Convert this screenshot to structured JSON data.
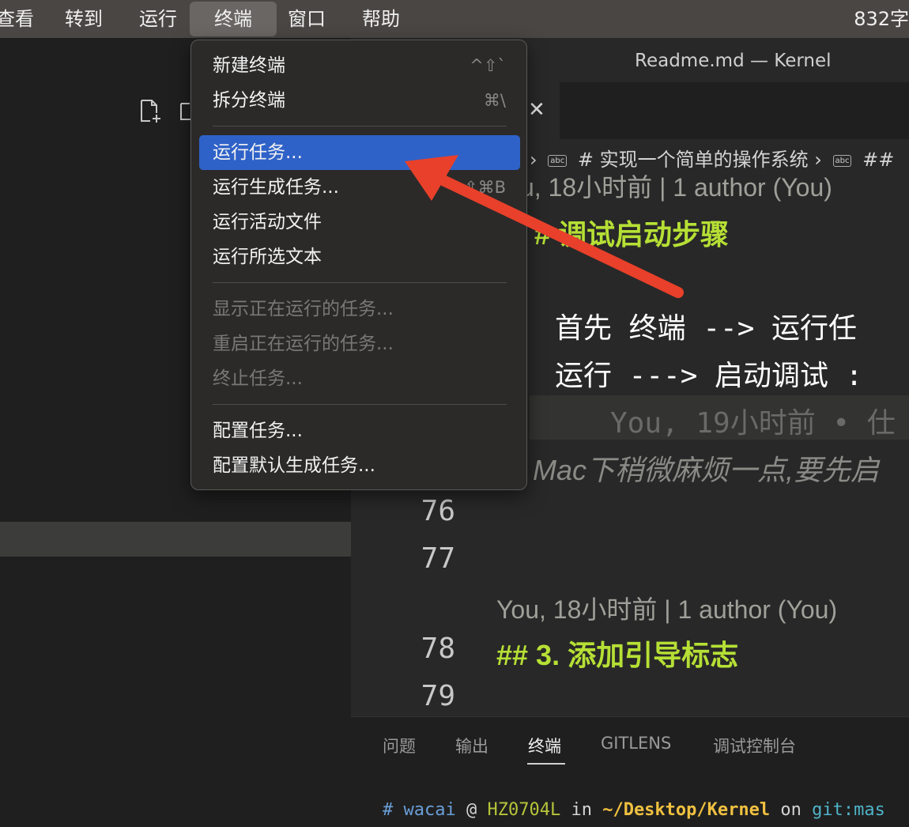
{
  "menubar": {
    "items": [
      "查看",
      "转到",
      "运行",
      "终端",
      "窗口",
      "帮助"
    ],
    "word_count": "832字"
  },
  "window_title": "Readme.md — Kernel",
  "breadcrumb": {
    "part1": "# 实现一个简单的操作系统",
    "part2": "##",
    "icon": "abc"
  },
  "editor": {
    "blame_top": "u, 18小时前 | 1 author (You)",
    "heading_top": "# 调试启动步骤",
    "line_a": "首先  终端  -->   运行任",
    "line_b": "运行  --->  启动调试  :",
    "ghost_blame": "You, 19小时前 • 仕",
    "italic_line": "Mac下稍微麻烦一点,要先启",
    "lines": [
      {
        "num": "76",
        "text": ""
      },
      {
        "num": "77",
        "text": ""
      },
      {
        "num": "78",
        "text": "## 3. 添加引导标志"
      },
      {
        "num": "79",
        "text": ""
      }
    ],
    "blame_78": "You, 18小时前 | 1 author (You)"
  },
  "panel": {
    "tabs": [
      "问题",
      "输出",
      "终端",
      "GITLENS",
      "调试控制台"
    ],
    "active_tab": "终端",
    "terminal": {
      "hash": "#",
      "user": "wacai",
      "at": "@",
      "host": "HZ0704L",
      "in": "in",
      "path": "~/Desktop/Kernel",
      "on": "on",
      "git": "git:mas"
    }
  },
  "terminal_menu": {
    "groups": [
      [
        {
          "label": "新建终端",
          "shortcut": "^⇧`",
          "disabled": false
        },
        {
          "label": "拆分终端",
          "shortcut": "⌘\\",
          "disabled": false
        }
      ],
      [
        {
          "label": "运行任务...",
          "shortcut": "",
          "disabled": false,
          "selected": true
        },
        {
          "label": "运行生成任务...",
          "shortcut": "⇧⌘B",
          "disabled": false
        },
        {
          "label": "运行活动文件",
          "shortcut": "",
          "disabled": false
        },
        {
          "label": "运行所选文本",
          "shortcut": "",
          "disabled": false
        }
      ],
      [
        {
          "label": "显示正在运行的任务...",
          "shortcut": "",
          "disabled": true
        },
        {
          "label": "重启正在运行的任务...",
          "shortcut": "",
          "disabled": true
        },
        {
          "label": "终止任务...",
          "shortcut": "",
          "disabled": true
        }
      ],
      [
        {
          "label": "配置任务...",
          "shortcut": "",
          "disabled": false
        },
        {
          "label": "配置默认生成任务...",
          "shortcut": "",
          "disabled": false
        }
      ]
    ]
  },
  "colors": {
    "selection": "#2f62c8",
    "heading_green": "#b6e035",
    "annotation_arrow": "#e8402a",
    "term_user": "#6a9fd8",
    "term_host": "#b6c43a",
    "term_path": "#f0c040",
    "term_git": "#4fb3c8"
  }
}
